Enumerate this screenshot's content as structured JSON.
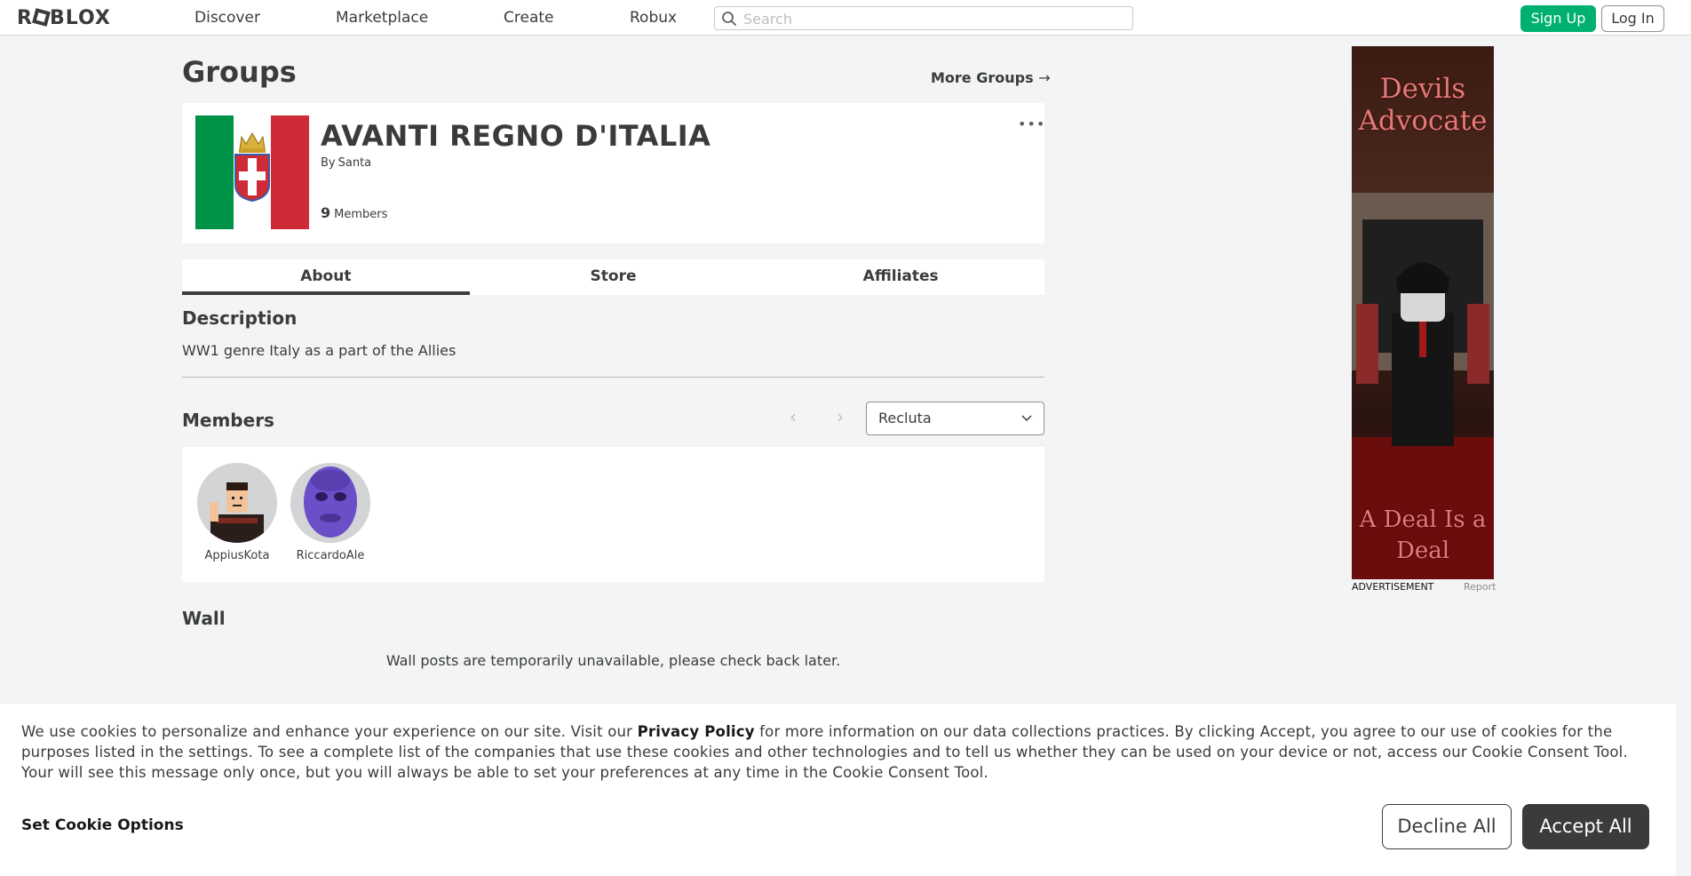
{
  "nav": {
    "logo": "ROBLOX",
    "links": [
      "Discover",
      "Marketplace",
      "Create",
      "Robux"
    ],
    "search_placeholder": "Search",
    "signup": "Sign Up",
    "login": "Log In"
  },
  "page": {
    "title": "Groups",
    "more_groups": "More Groups",
    "more_groups_arrow": "→"
  },
  "group": {
    "name": "AVANTI REGNO D'ITALIA",
    "by_label": "By",
    "owner": "Santa",
    "member_count": "9",
    "member_label": "Members",
    "more_dots": "•••"
  },
  "tabs": [
    "About",
    "Store",
    "Affiliates"
  ],
  "description": {
    "title": "Description",
    "text": "WW1 genre Italy as a part of the Allies"
  },
  "members": {
    "title": "Members",
    "prev": "‹",
    "next": "›",
    "rank_selected": "Recluta",
    "list": [
      {
        "name": "AppiusKota"
      },
      {
        "name": "RiccardoAle"
      }
    ]
  },
  "wall": {
    "title": "Wall",
    "message": "Wall posts are temporarily unavailable, please check back later."
  },
  "ad": {
    "top_text": "Devils Advocate",
    "bottom_text": "A Deal Is a Deal",
    "label": "ADVERTISEMENT",
    "report": "Report"
  },
  "cookie": {
    "text_before": "We use cookies to personalize and enhance your experience on our site. Visit our ",
    "privacy_policy": "Privacy Policy",
    "text_after": " for more information on our data collections practices. By clicking Accept, you agree to our use of cookies for the purposes listed in the settings. To see a complete list of the companies that use these cookies and other technologies and to tell us whether they can be used on your device or not, access our Cookie Consent Tool. Your will see this message only once, but you will always be able to set your preferences at any time in the Cookie Consent Tool.",
    "set_options": "Set Cookie Options",
    "decline": "Decline All",
    "accept": "Accept All"
  },
  "colors": {
    "signup_green": "#00b06f",
    "accent_dark": "#393b3d",
    "page_bg": "#f2f4f5",
    "flag_green": "#009246",
    "flag_red": "#ce2b37"
  }
}
